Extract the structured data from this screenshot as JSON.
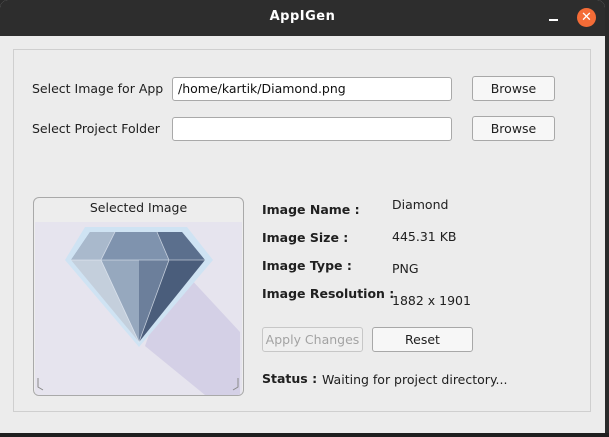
{
  "window": {
    "title": "AppIGen",
    "close_glyph": "✕"
  },
  "form": {
    "image_label": "Select Image for App",
    "image_path": "/home/kartik/Diamond.png",
    "folder_label": "Select Project Folder",
    "folder_path": "",
    "browse_label": "Browse"
  },
  "preview": {
    "title": "Selected Image",
    "icon": "diamond-image"
  },
  "info": {
    "name_key": "Image Name :",
    "name_val": "Diamond",
    "size_key": "Image Size :",
    "size_val": "445.31 KB",
    "type_key": "Image Type :",
    "type_val": "PNG",
    "res_key": "Image Resolution :",
    "res_val": "1882 x 1901"
  },
  "actions": {
    "apply_label": "Apply Changes",
    "reset_label": "Reset"
  },
  "status": {
    "key": "Status :",
    "message": "Waiting for project directory..."
  },
  "colors": {
    "titlebar": "#2d2d2d",
    "close_button": "#f46c37",
    "window_bg": "#ececec",
    "image_bg": "#e6e4ee"
  }
}
